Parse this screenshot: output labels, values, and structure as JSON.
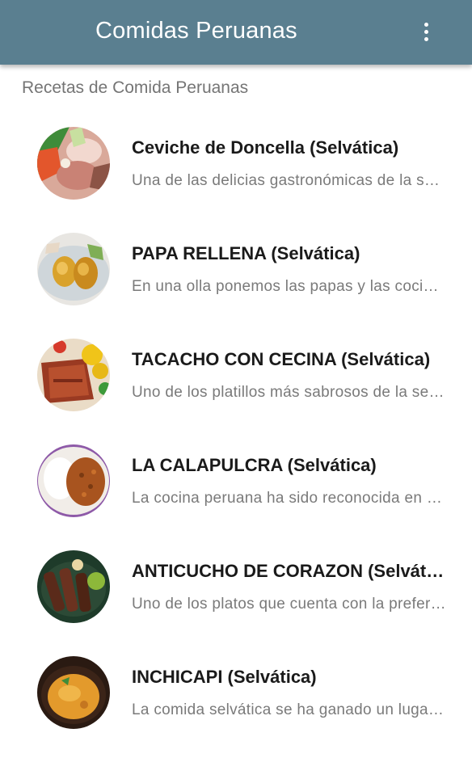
{
  "app": {
    "title": "Comidas Peruanas",
    "overflow_icon": "more-vert-icon",
    "bar_color": "#5a7f90"
  },
  "section": {
    "header": "Recetas de Comida Peruanas"
  },
  "recipes": [
    {
      "title": "Ceviche de Doncella (Selvática)",
      "desc": "Una de las delicias gastronómicas de la selva peruana",
      "image": "ceviche-image"
    },
    {
      "title": "PAPA RELLENA (Selvática)",
      "desc": "En una olla ponemos las papas y las cocinamos",
      "image": "papa-rellena-image"
    },
    {
      "title": "TACACHO CON CECINA (Selvática)",
      "desc": "Uno de los platillos más sabrosos de la selva",
      "image": "tacacho-image"
    },
    {
      "title": "LA CALAPULCRA (Selvática)",
      "desc": "La cocina peruana ha sido reconocida en el mundo",
      "image": "calapulcra-image"
    },
    {
      "title": "ANTICUCHO DE CORAZON (Selvática)",
      "desc": "Uno de los platos que cuenta con la preferencia",
      "image": "anticucho-image"
    },
    {
      "title": "INCHICAPI (Selvática)",
      "desc": "La comida selvática se ha ganado un lugar especial",
      "image": "inchicapi-image"
    }
  ]
}
